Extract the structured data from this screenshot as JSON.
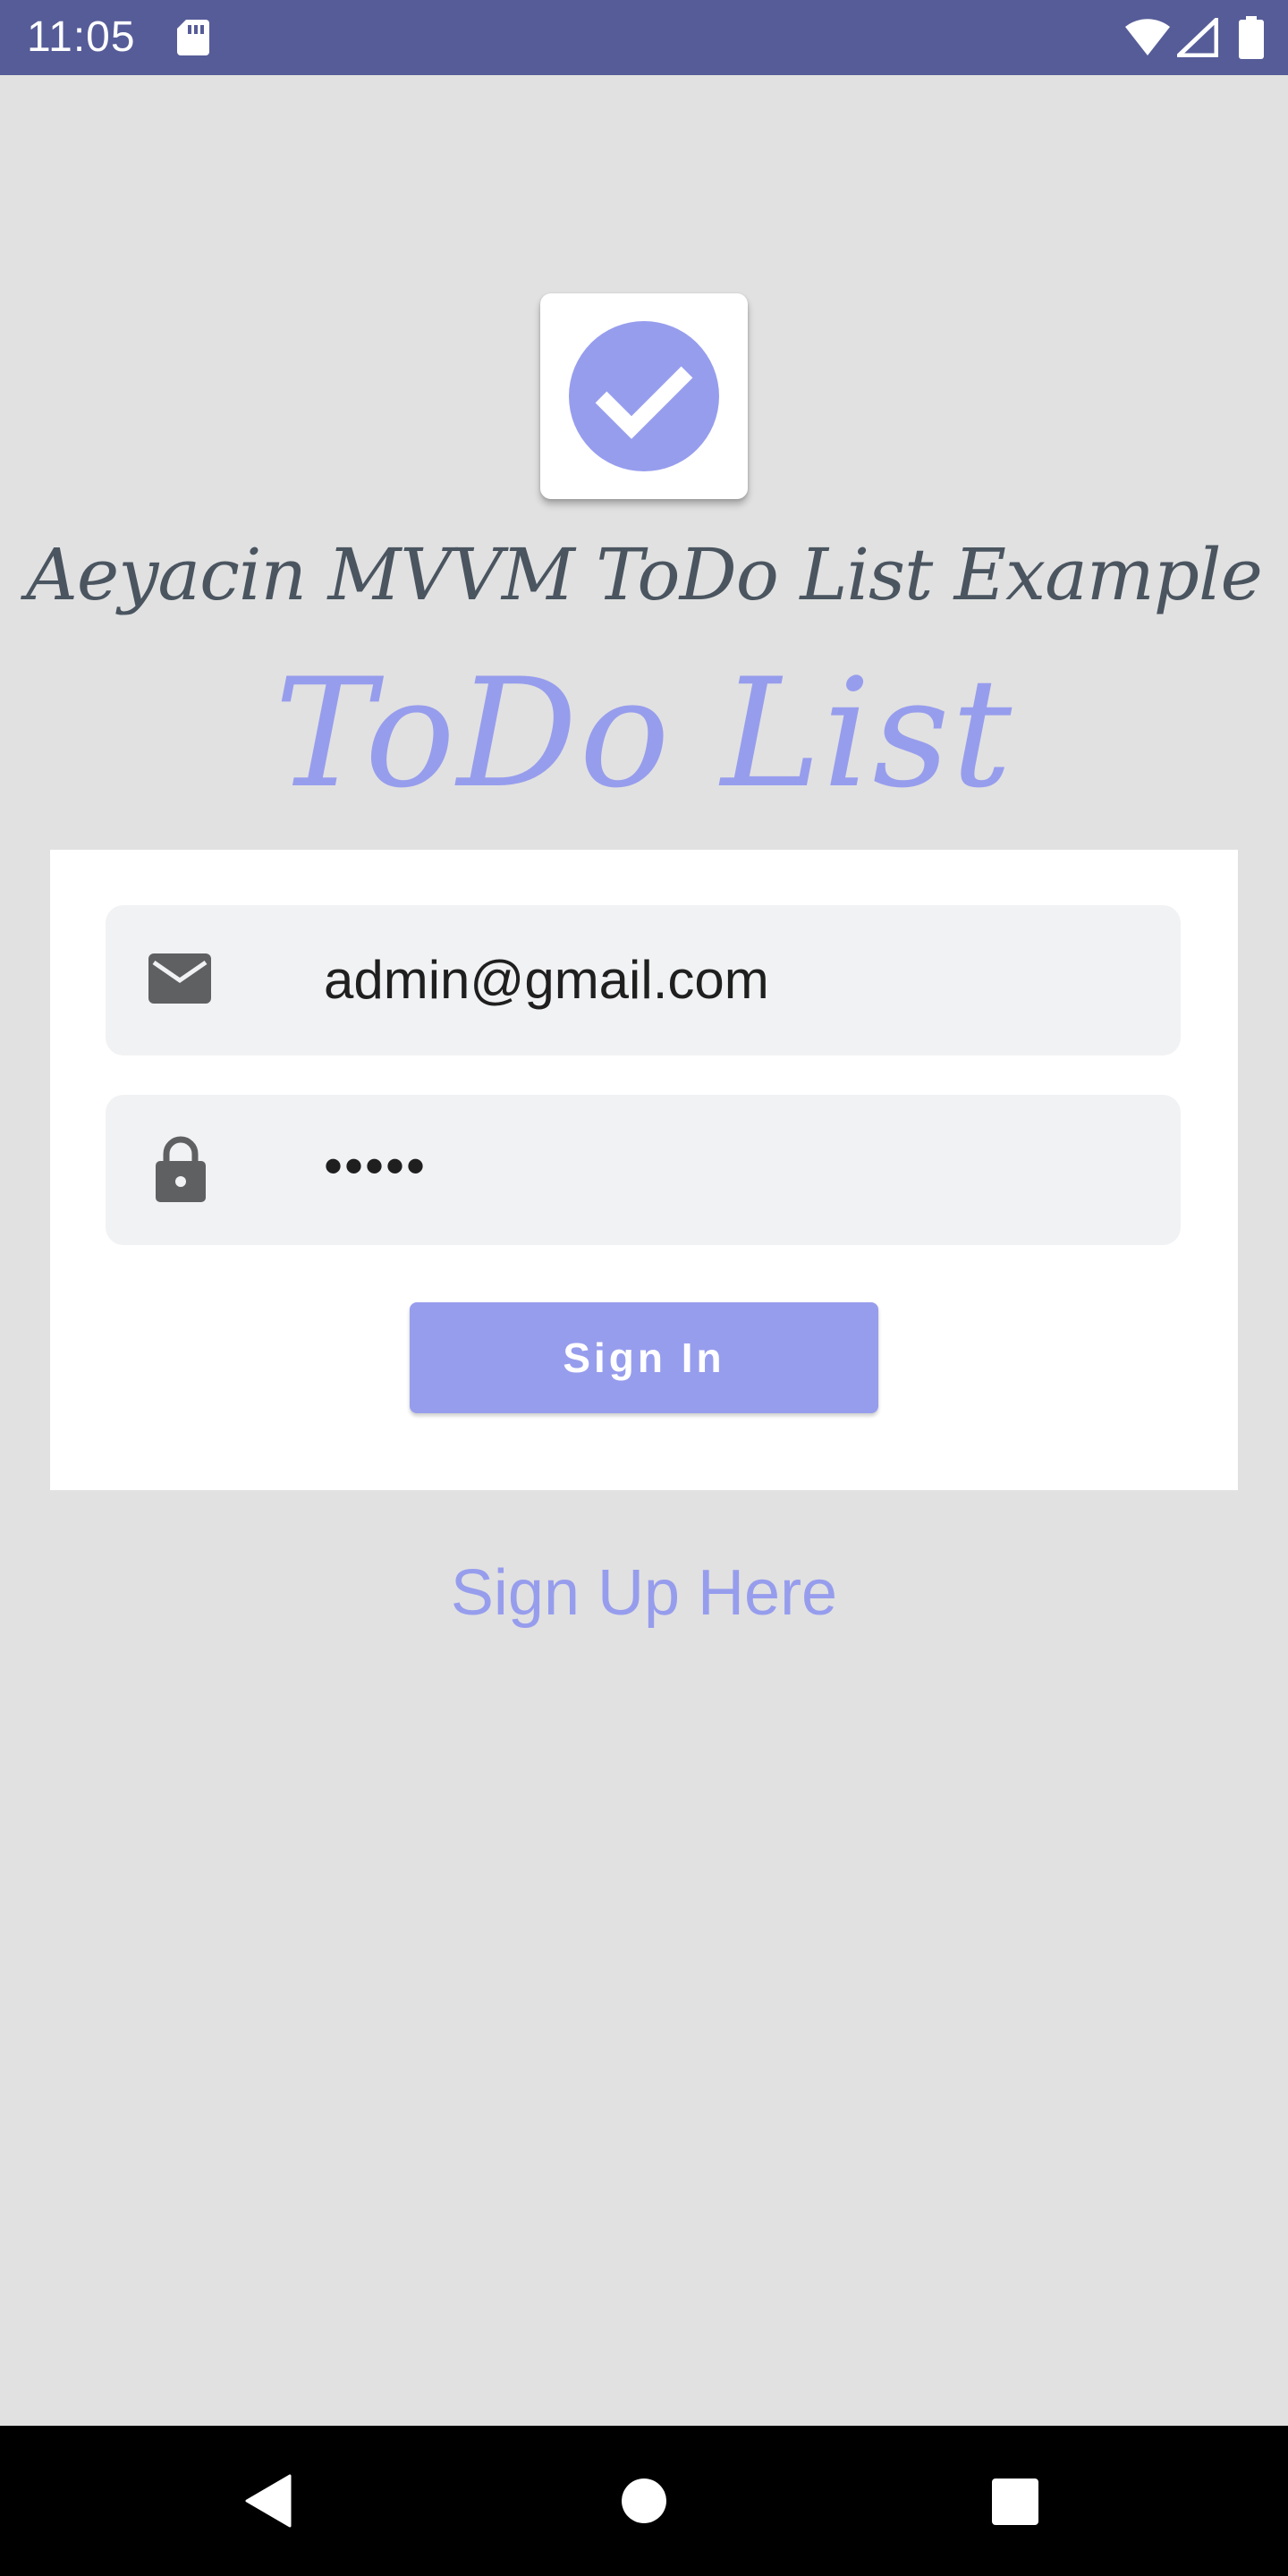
{
  "status_bar": {
    "time": "11:05",
    "icons": [
      "sd-card-icon",
      "wifi-icon",
      "cell-signal-icon",
      "battery-icon"
    ],
    "background": "#565c98"
  },
  "app": {
    "logo_icon": "check-circle-icon",
    "subtitle": "Aeyacin MVVM ToDo List Example",
    "title": "ToDo List"
  },
  "login_form": {
    "email": {
      "icon": "mail-icon",
      "value": "admin@gmail.com"
    },
    "password": {
      "icon": "lock-icon",
      "value": "•••••"
    },
    "signin_label": "Sign In"
  },
  "signup_link_label": "Sign Up Here",
  "nav_bar": {
    "icons": [
      "back-icon",
      "home-icon",
      "recents-icon"
    ]
  },
  "colors": {
    "accent": "#979ded",
    "page_background": "#e1e1e1",
    "card_background": "#ffffff",
    "field_background": "#f1f2f4",
    "subtitle_text": "#4a5560"
  }
}
